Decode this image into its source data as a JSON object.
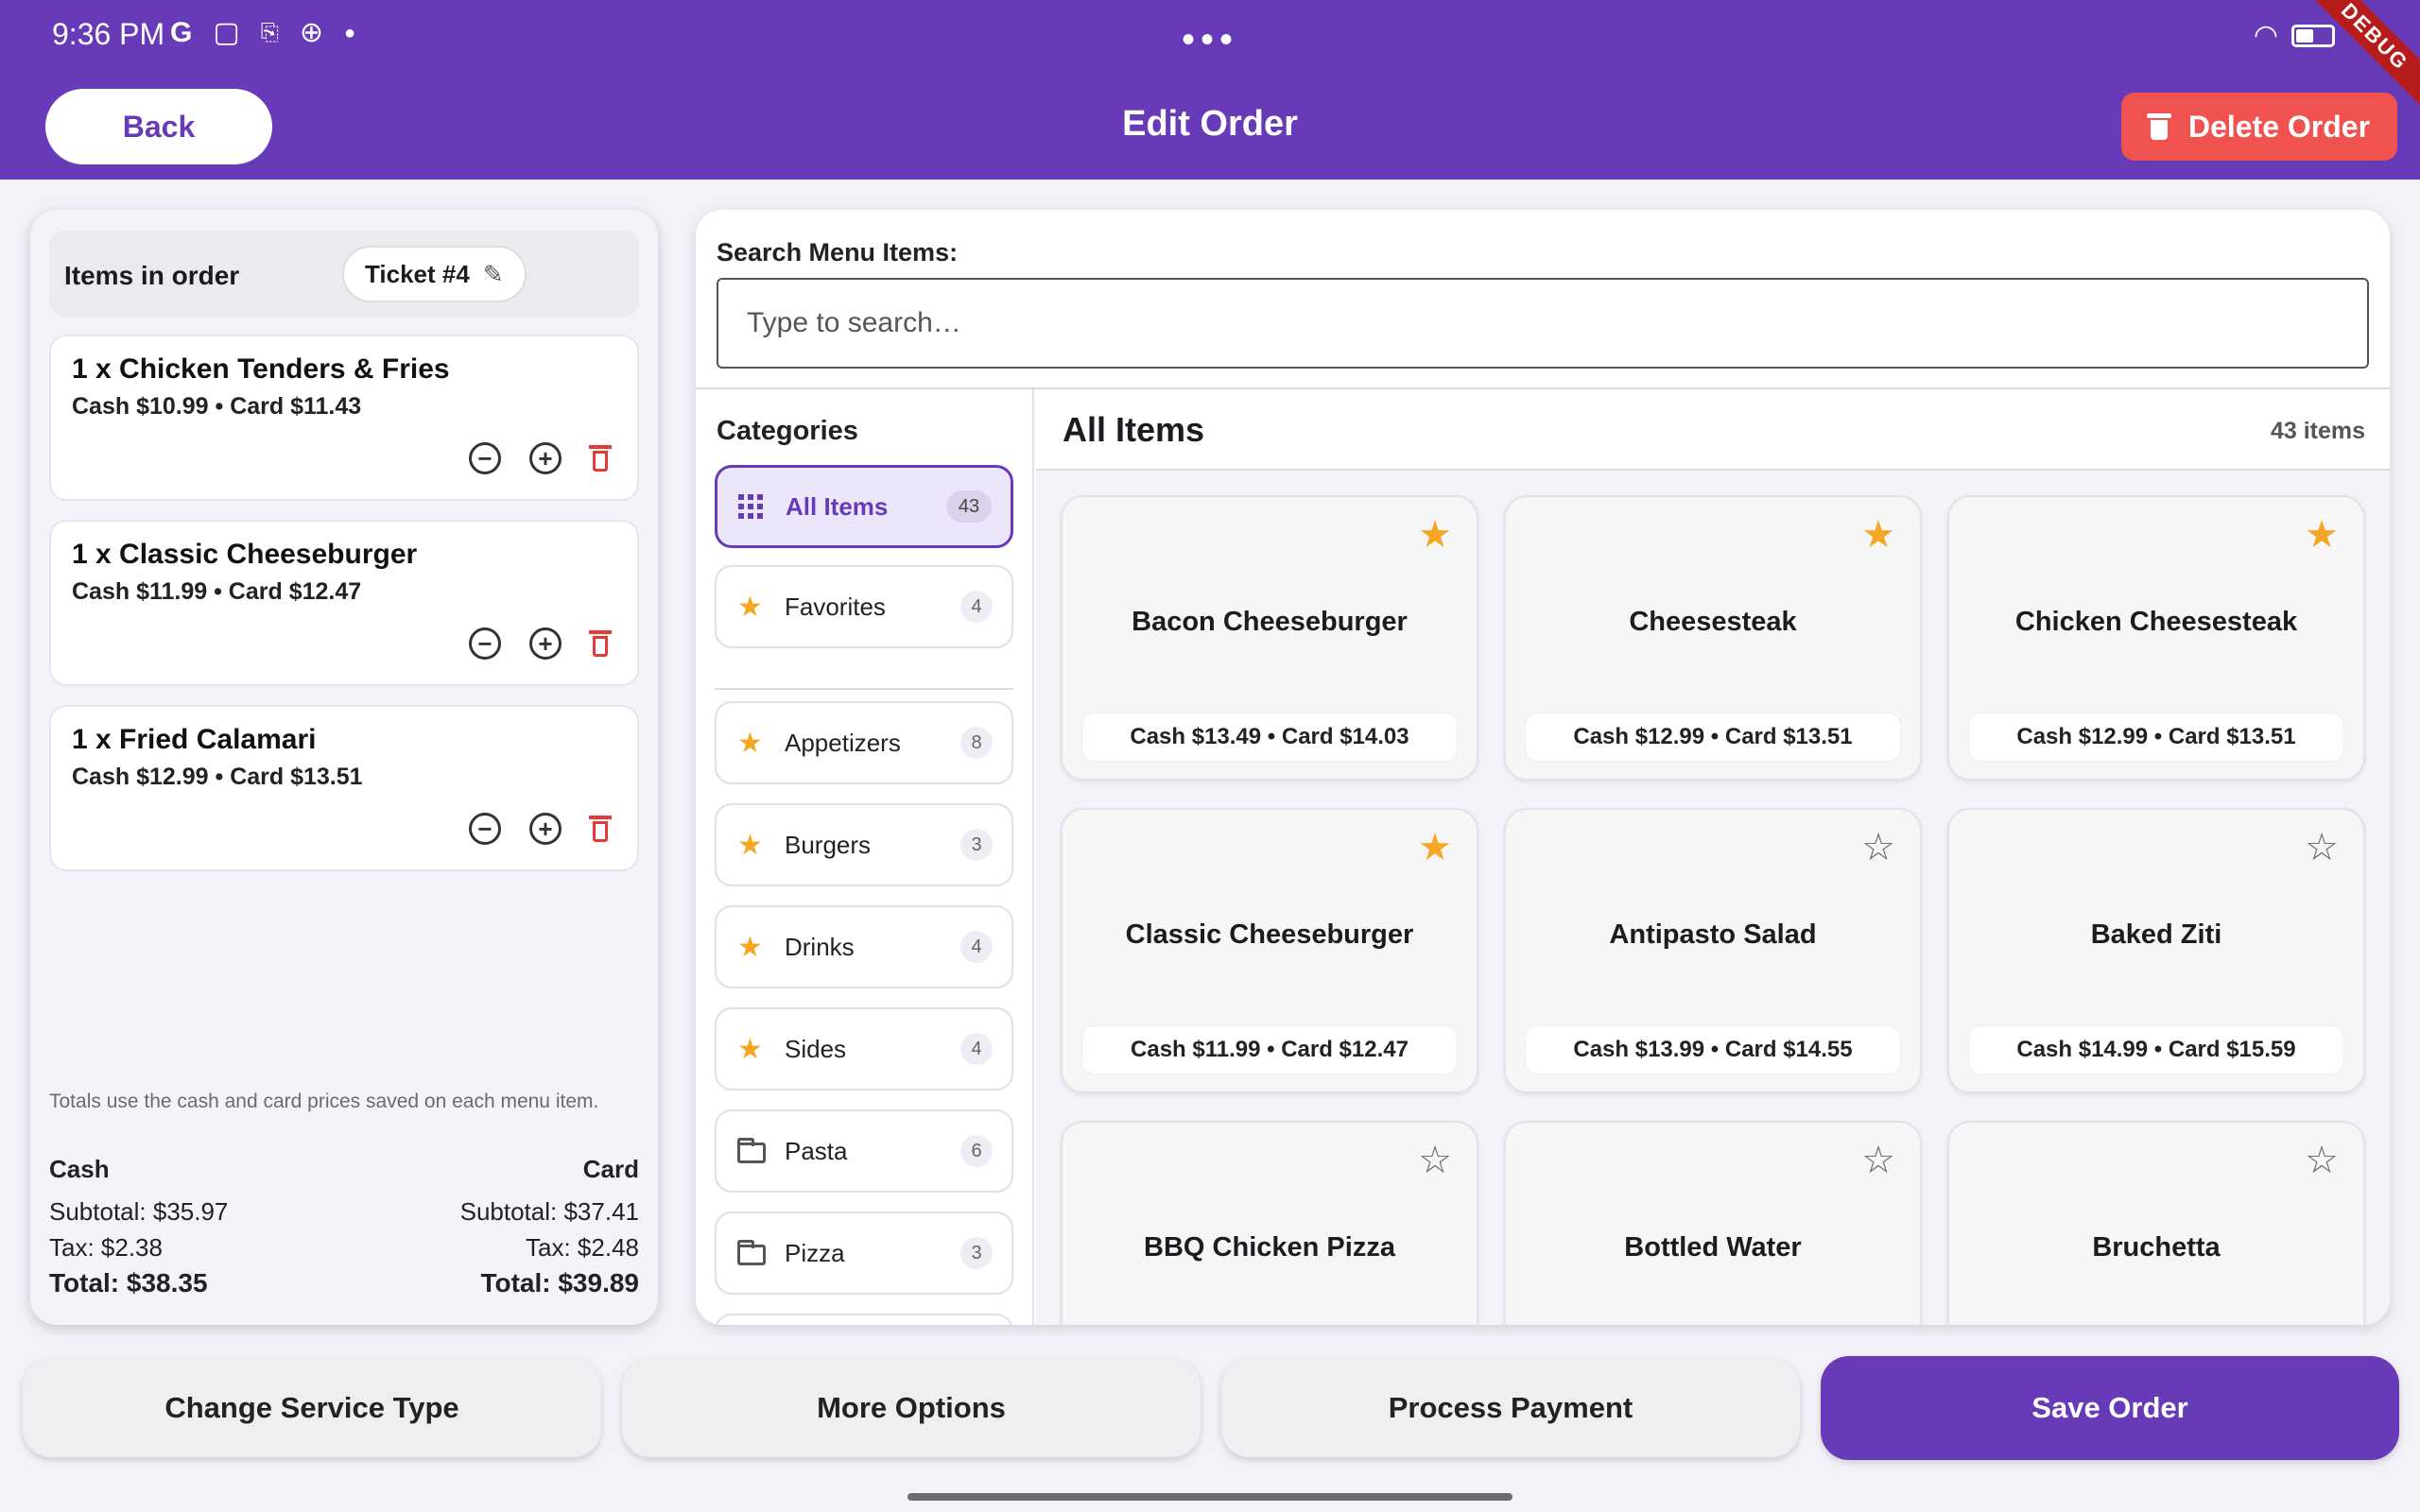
{
  "status_bar": {
    "time": "9:36 PM",
    "left_icons": [
      "google-icon",
      "screenshot-icon",
      "cast-icon",
      "basketball-icon",
      "dot-icon"
    ],
    "center": "•••",
    "debug": "DEBUG"
  },
  "header": {
    "back_label": "Back",
    "title": "Edit Order",
    "delete_label": "Delete Order"
  },
  "order": {
    "title": "Items in order",
    "ticket": "Ticket #4",
    "items": [
      {
        "name": "1 x Chicken Tenders & Fries",
        "prices": "Cash $10.99  •  Card $11.43"
      },
      {
        "name": "1 x Classic Cheeseburger",
        "prices": "Cash $11.99  •  Card $12.47"
      },
      {
        "name": "1 x Fried Calamari",
        "prices": "Cash $12.99  •  Card $13.51"
      }
    ],
    "note": "Totals use the cash and card prices saved on each menu item.",
    "cash": {
      "head": "Cash",
      "subtotal": "Subtotal: $35.97",
      "tax": "Tax: $2.38",
      "total": "Total: $38.35"
    },
    "card": {
      "head": "Card",
      "subtotal": "Subtotal: $37.41",
      "tax": "Tax: $2.48",
      "total": "Total: $39.89"
    }
  },
  "search": {
    "label": "Search Menu Items:",
    "placeholder": "Type to search…"
  },
  "categories": {
    "title": "Categories",
    "items": [
      {
        "label": "All Items",
        "count": "43",
        "icon": "grid-icon"
      },
      {
        "label": "Favorites",
        "count": "4",
        "icon": "star-icon"
      },
      {
        "label": "Appetizers",
        "count": "8",
        "icon": "star-icon"
      },
      {
        "label": "Burgers",
        "count": "3",
        "icon": "star-icon"
      },
      {
        "label": "Drinks",
        "count": "4",
        "icon": "star-icon"
      },
      {
        "label": "Sides",
        "count": "4",
        "icon": "star-icon"
      },
      {
        "label": "Pasta",
        "count": "6",
        "icon": "folder-icon"
      },
      {
        "label": "Pizza",
        "count": "3",
        "icon": "folder-icon"
      }
    ]
  },
  "items": {
    "title": "All Items",
    "count": "43 items",
    "cards": [
      {
        "name": "Bacon Cheeseburger",
        "prices": "Cash $13.49  •  Card $14.03",
        "favorite": true
      },
      {
        "name": "Cheesesteak",
        "prices": "Cash $12.99  •  Card $13.51",
        "favorite": true
      },
      {
        "name": "Chicken Cheesesteak",
        "prices": "Cash $12.99  •  Card $13.51",
        "favorite": true
      },
      {
        "name": "Classic Cheeseburger",
        "prices": "Cash $11.99  •  Card $12.47",
        "favorite": true
      },
      {
        "name": "Antipasto Salad",
        "prices": "Cash $13.99  •  Card $14.55",
        "favorite": false
      },
      {
        "name": "Baked Ziti",
        "prices": "Cash $14.99  •  Card $15.59",
        "favorite": false
      },
      {
        "name": "BBQ Chicken Pizza",
        "prices": "",
        "favorite": false
      },
      {
        "name": "Bottled Water",
        "prices": "",
        "favorite": false
      },
      {
        "name": "Bruchetta",
        "prices": "",
        "favorite": false
      }
    ]
  },
  "bottom": {
    "change_service": "Change Service Type",
    "more_options": "More Options",
    "process_payment": "Process Payment",
    "save_order": "Save Order"
  },
  "colors": {
    "primary": "#673ab7",
    "danger": "#f0524f",
    "favorite": "#f5a623"
  }
}
